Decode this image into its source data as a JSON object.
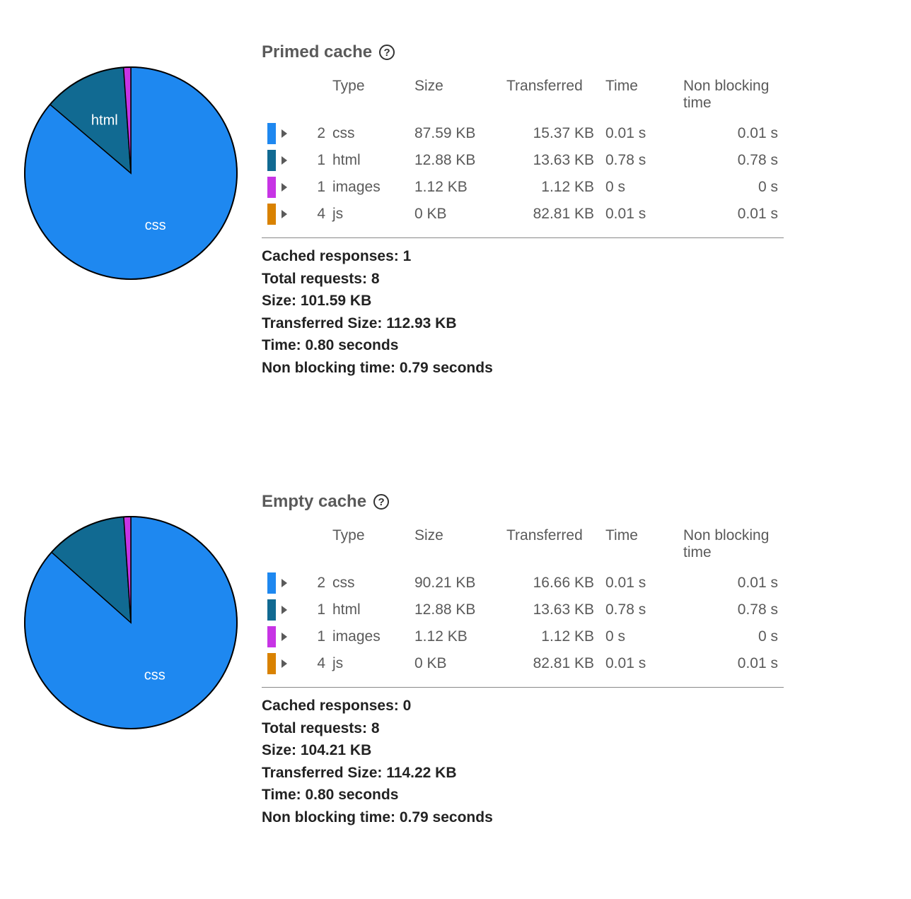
{
  "colors": {
    "css": "#1e88f0",
    "html": "#116a92",
    "images": "#c734e5",
    "js": "#d98200"
  },
  "columns": {
    "type": "Type",
    "size": "Size",
    "transferred": "Transferred",
    "time": "Time",
    "nbt": "Non blocking time"
  },
  "summary_labels": {
    "cached": "Cached responses:",
    "total": "Total requests:",
    "size": "Size:",
    "transferred": "Transferred Size:",
    "time": "Time:",
    "nbt": "Non blocking time:"
  },
  "sections": [
    {
      "id": "primed",
      "title": "Primed cache",
      "pie_labels": {
        "css": "css",
        "html": "html"
      },
      "rows": [
        {
          "count": "2",
          "type": "css",
          "size": "87.59 KB",
          "transferred": "15.37 KB",
          "time": "0.01 s",
          "nbt": "0.01 s",
          "color_key": "css"
        },
        {
          "count": "1",
          "type": "html",
          "size": "12.88 KB",
          "transferred": "13.63 KB",
          "time": "0.78 s",
          "nbt": "0.78 s",
          "color_key": "html"
        },
        {
          "count": "1",
          "type": "images",
          "size": "1.12 KB",
          "transferred": "1.12 KB",
          "time": "0 s",
          "nbt": "0 s",
          "color_key": "images"
        },
        {
          "count": "4",
          "type": "js",
          "size": "0 KB",
          "transferred": "82.81 KB",
          "time": "0.01 s",
          "nbt": "0.01 s",
          "color_key": "js"
        }
      ],
      "summary": {
        "cached": "1",
        "total": "8",
        "size": "101.59 KB",
        "transferred": "112.93 KB",
        "time": "0.80 seconds",
        "nbt": "0.79 seconds"
      }
    },
    {
      "id": "empty",
      "title": "Empty cache",
      "pie_labels": {
        "css": "css"
      },
      "rows": [
        {
          "count": "2",
          "type": "css",
          "size": "90.21 KB",
          "transferred": "16.66 KB",
          "time": "0.01 s",
          "nbt": "0.01 s",
          "color_key": "css"
        },
        {
          "count": "1",
          "type": "html",
          "size": "12.88 KB",
          "transferred": "13.63 KB",
          "time": "0.78 s",
          "nbt": "0.78 s",
          "color_key": "html"
        },
        {
          "count": "1",
          "type": "images",
          "size": "1.12 KB",
          "transferred": "1.12 KB",
          "time": "0 s",
          "nbt": "0 s",
          "color_key": "images"
        },
        {
          "count": "4",
          "type": "js",
          "size": "0 KB",
          "transferred": "82.81 KB",
          "time": "0.01 s",
          "nbt": "0.01 s",
          "color_key": "js"
        }
      ],
      "summary": {
        "cached": "0",
        "total": "8",
        "size": "104.21 KB",
        "transferred": "114.22 KB",
        "time": "0.80 seconds",
        "nbt": "0.79 seconds"
      }
    }
  ],
  "chart_data": [
    {
      "type": "pie",
      "title": "Primed cache — size by type",
      "series": [
        {
          "name": "css",
          "value": 87.59,
          "unit": "KB"
        },
        {
          "name": "html",
          "value": 12.88,
          "unit": "KB"
        },
        {
          "name": "images",
          "value": 1.12,
          "unit": "KB"
        },
        {
          "name": "js",
          "value": 0,
          "unit": "KB"
        }
      ]
    },
    {
      "type": "pie",
      "title": "Empty cache — size by type",
      "series": [
        {
          "name": "css",
          "value": 90.21,
          "unit": "KB"
        },
        {
          "name": "html",
          "value": 12.88,
          "unit": "KB"
        },
        {
          "name": "images",
          "value": 1.12,
          "unit": "KB"
        },
        {
          "name": "js",
          "value": 0,
          "unit": "KB"
        }
      ]
    }
  ]
}
